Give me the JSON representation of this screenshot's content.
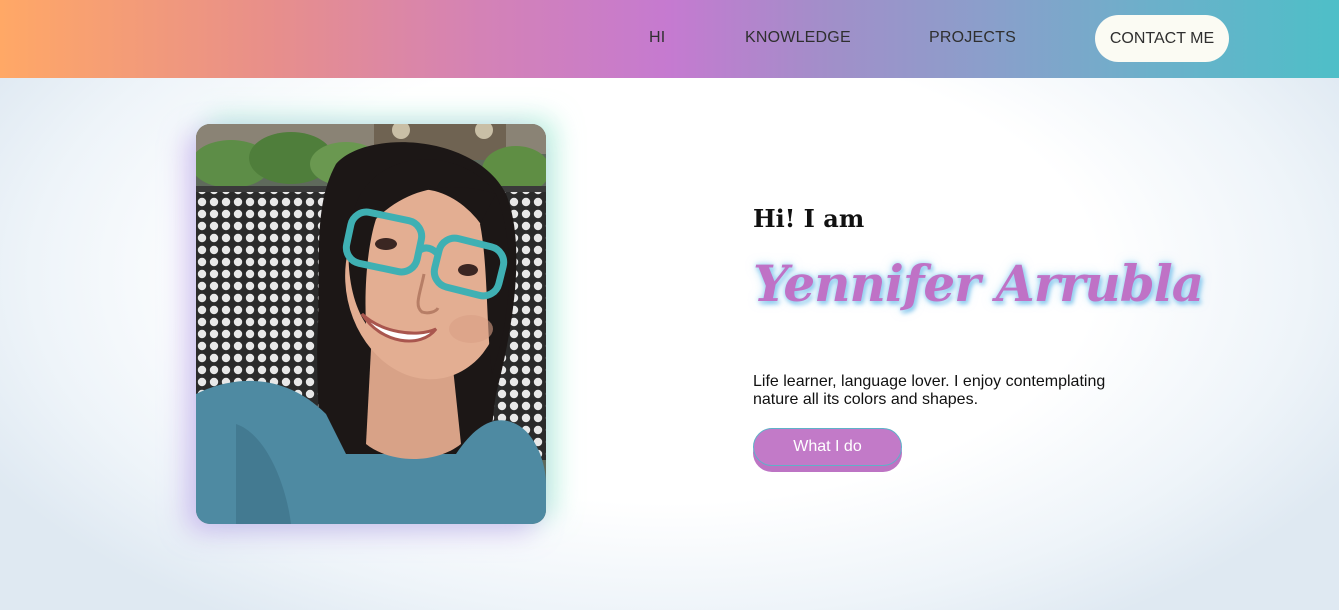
{
  "nav": {
    "items": [
      {
        "label": "HI"
      },
      {
        "label": "KNOWLEDGE"
      },
      {
        "label": "PROJECTS"
      }
    ],
    "contact_label": "CONTACT ME"
  },
  "hero": {
    "greeting": "Hi! I am",
    "name": "Yennifer Arrubla",
    "tagline": "Life learner, language lover. I enjoy contemplating nature all its colors and shapes.",
    "cta_label": "What I do",
    "photo_icon": "profile-photo"
  },
  "colors": {
    "nav_gradient": [
      "#ffa866",
      "#c57ad0",
      "#4ebfc8"
    ],
    "accent": "#bf72c6",
    "button": "#c27ac8",
    "contact_bg": "#fbfbf3"
  }
}
